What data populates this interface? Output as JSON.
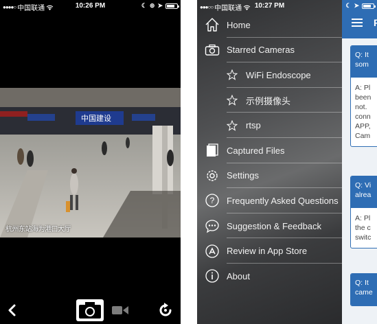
{
  "left_screen": {
    "status": {
      "signal_dots": "●●●●○",
      "carrier": "中国联通",
      "time": "10:26 PM"
    },
    "video_caption": "杭州东站海为港口大厅",
    "video_banner": "中国建设",
    "toolbar": {
      "back": "back",
      "capture": "camera",
      "record": "video-camera",
      "rotate": "rotate"
    }
  },
  "right_screen": {
    "status": {
      "signal_dots": "●●●○○",
      "carrier": "中国联通",
      "time": "10:27 PM"
    },
    "menu": [
      {
        "label": "Home",
        "icon": "home-icon",
        "sub": false
      },
      {
        "label": "Starred Cameras",
        "icon": "camera-icon",
        "sub": false
      },
      {
        "label": "WiFi Endoscope",
        "icon": "star-icon",
        "sub": true
      },
      {
        "label": "示例摄像头",
        "icon": "star-icon",
        "sub": true
      },
      {
        "label": "rtsp",
        "icon": "star-icon",
        "sub": true
      },
      {
        "label": "Captured Files",
        "icon": "files-icon",
        "sub": false
      },
      {
        "label": "Settings",
        "icon": "gear-icon",
        "sub": false
      },
      {
        "label": "Frequently Asked Questions",
        "icon": "question-icon",
        "sub": false
      },
      {
        "label": "Suggestion & Feedback",
        "icon": "chat-icon",
        "sub": false
      },
      {
        "label": "Review in App Store",
        "icon": "app-store-icon",
        "sub": false
      },
      {
        "label": "About",
        "icon": "info-icon",
        "sub": false
      }
    ],
    "content": {
      "title_fragment": "F",
      "cards": [
        {
          "q": [
            "Q: It",
            "som"
          ],
          "a": [
            "A: Pl",
            "been",
            "not.",
            "conn",
            "APP,",
            "Cam"
          ]
        },
        {
          "q": [
            "Q: Vi",
            "alrea"
          ],
          "a": [
            "A: Pl",
            "the c",
            "switc"
          ]
        },
        {
          "q": [
            "Q: It",
            "came"
          ],
          "a": []
        }
      ]
    },
    "colors": {
      "accent": "#2e6db4"
    }
  }
}
